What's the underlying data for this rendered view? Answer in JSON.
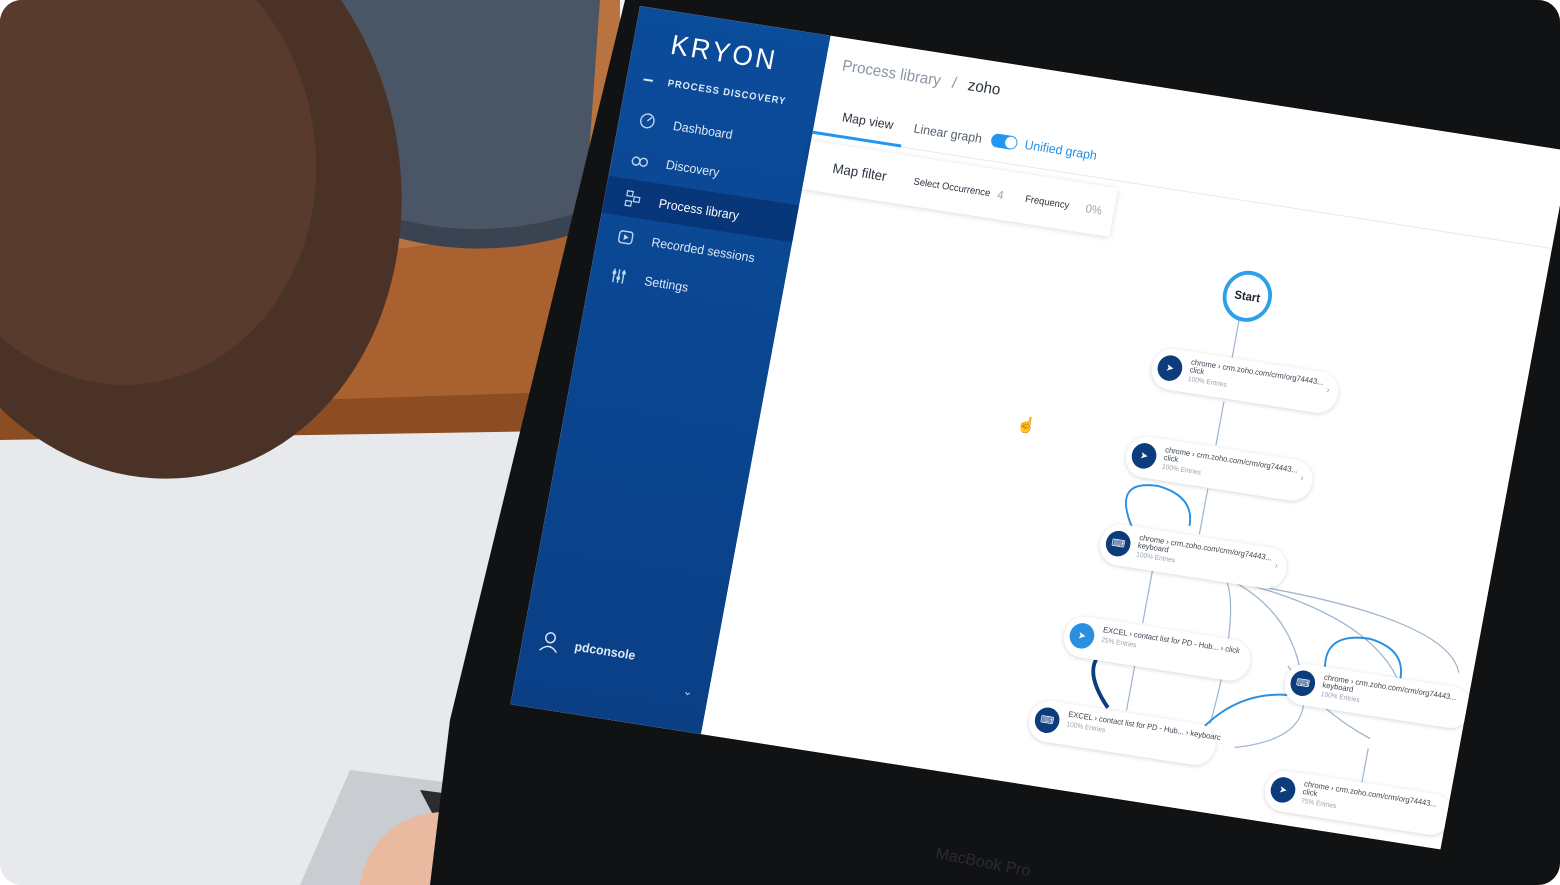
{
  "app": {
    "logo": "KRYON",
    "section": "PROCESS DISCOVERY",
    "nav": [
      {
        "label": "Dashboard",
        "icon": "gauge-icon"
      },
      {
        "label": "Discovery",
        "icon": "binoculars-icon"
      },
      {
        "label": "Process library",
        "icon": "library-icon",
        "active": true
      },
      {
        "label": "Recorded sessions",
        "icon": "play-icon"
      },
      {
        "label": "Settings",
        "icon": "sliders-icon"
      }
    ],
    "user": "pdconsole"
  },
  "main": {
    "breadcrumb": {
      "parent": "Process library",
      "separator": "/",
      "current": "zoho"
    },
    "tabs": [
      "Map view",
      "Linear graph"
    ],
    "toggle_label": "Unified graph",
    "filter": {
      "title": "Map filter",
      "occurrence_label": "Select Occurrence",
      "occurrence_value": "4",
      "frequency_label": "Frequency",
      "frequency_value": "0%"
    },
    "start_label": "Start",
    "nodes": [
      {
        "line1": "chrome › crm.zoho.com/crm/org74443...",
        "line2": "click",
        "entries": "100% Entries",
        "type": "click-icon"
      },
      {
        "line1": "chrome › crm.zoho.com/crm/org74443...",
        "line2": "click",
        "entries": "100% Entries",
        "type": "click-icon"
      },
      {
        "line1": "chrome › crm.zoho.com/crm/org74443...",
        "line2": "keyboard",
        "entries": "100% Entries",
        "type": "keyboard-icon"
      },
      {
        "line1": "EXCEL › contact list for PD - Hub... › click",
        "line2": "",
        "entries": "25% Entries",
        "type": "click-icon"
      },
      {
        "line1": "EXCEL › contact list for PD - Hub... › keyboarc",
        "line2": "",
        "entries": "100% Entries",
        "type": "keyboard-icon"
      },
      {
        "line1": "chrome › crm.zoho.com/crm/org74443...",
        "line2": "keyboard",
        "entries": "100% Entries",
        "type": "keyboard-icon"
      },
      {
        "line1": "chrome › crm.zoho.com/crm/org74443...",
        "line2": "click",
        "entries": "75% Entries",
        "type": "click-icon"
      }
    ]
  },
  "device_label": "MacBook Pro"
}
